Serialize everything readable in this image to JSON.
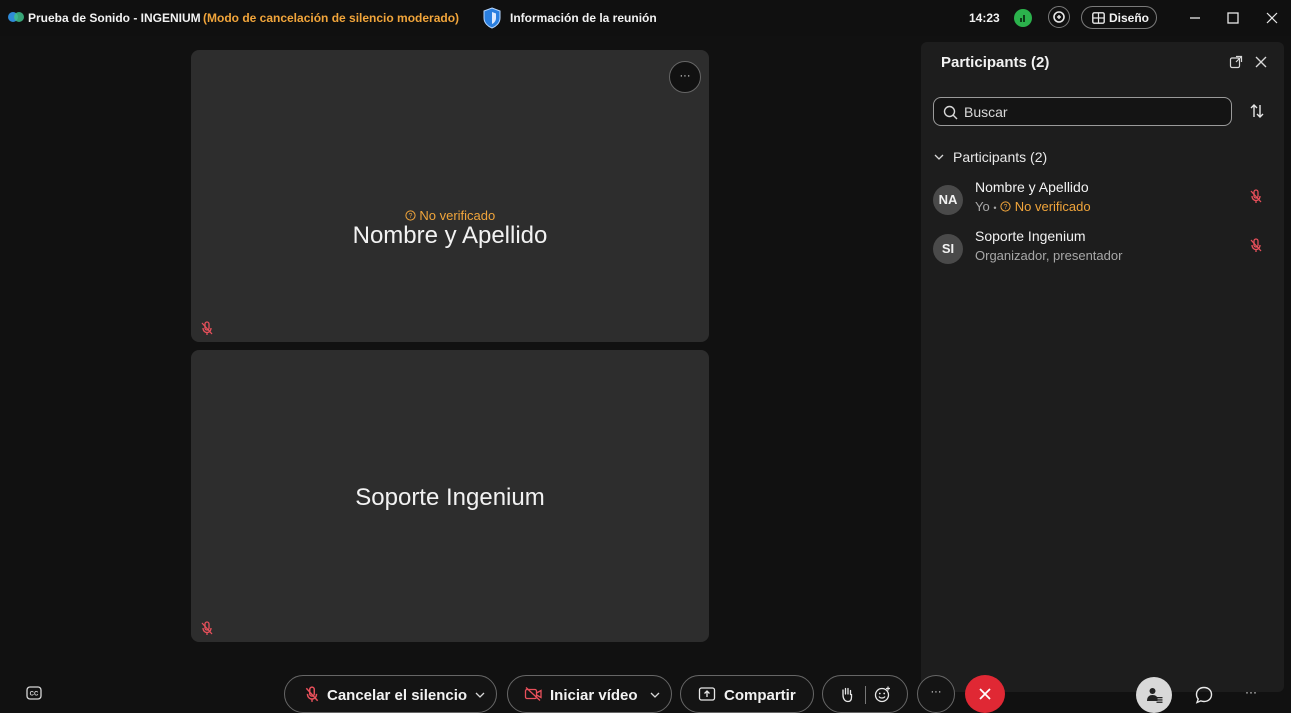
{
  "titlebar": {
    "title": "Prueba de Sonido - INGENIUM",
    "mode": "(Modo de cancelación de silencio moderado)",
    "meeting_info": "Información de la reunión",
    "time": "14:23",
    "layout_label": "Diseño"
  },
  "tiles": [
    {
      "name": "Nombre y Apellido",
      "status": "No verificado",
      "more_label": "···"
    },
    {
      "name": "Soporte Ingenium"
    }
  ],
  "panel": {
    "title": "Participants (2)",
    "search_placeholder": "Buscar",
    "section_label": "Participants (2)",
    "participants": [
      {
        "initials": "NA",
        "name": "Nombre y Apellido",
        "role": "Yo",
        "separator": "•",
        "status": "No verificado"
      },
      {
        "initials": "SI",
        "name": "Soporte Ingenium",
        "role": "Organizador, presentador"
      }
    ]
  },
  "controls": {
    "unmute_label": "Cancelar el silencio",
    "video_label": "Iniciar vídeo",
    "share_label": "Compartir",
    "more_label": "···",
    "more_right_label": "···"
  },
  "colors": {
    "accent_warning": "#f1a53b",
    "end_call": "#e02834",
    "muted_red": "#e8505b",
    "network_ok": "#2bb24c"
  },
  "icons": [
    "webex-logo-icon",
    "shield-icon",
    "network-icon",
    "zoom-icon",
    "layout-grid-icon",
    "minimize-icon",
    "maximize-icon",
    "close-icon",
    "microphone-muted-icon",
    "popout-icon",
    "search-icon",
    "sort-icon",
    "chevron-down-icon",
    "video-off-icon",
    "share-icon",
    "raise-hand-icon",
    "reaction-icon",
    "end-call-icon",
    "participants-icon",
    "chat-icon",
    "captions-icon"
  ]
}
